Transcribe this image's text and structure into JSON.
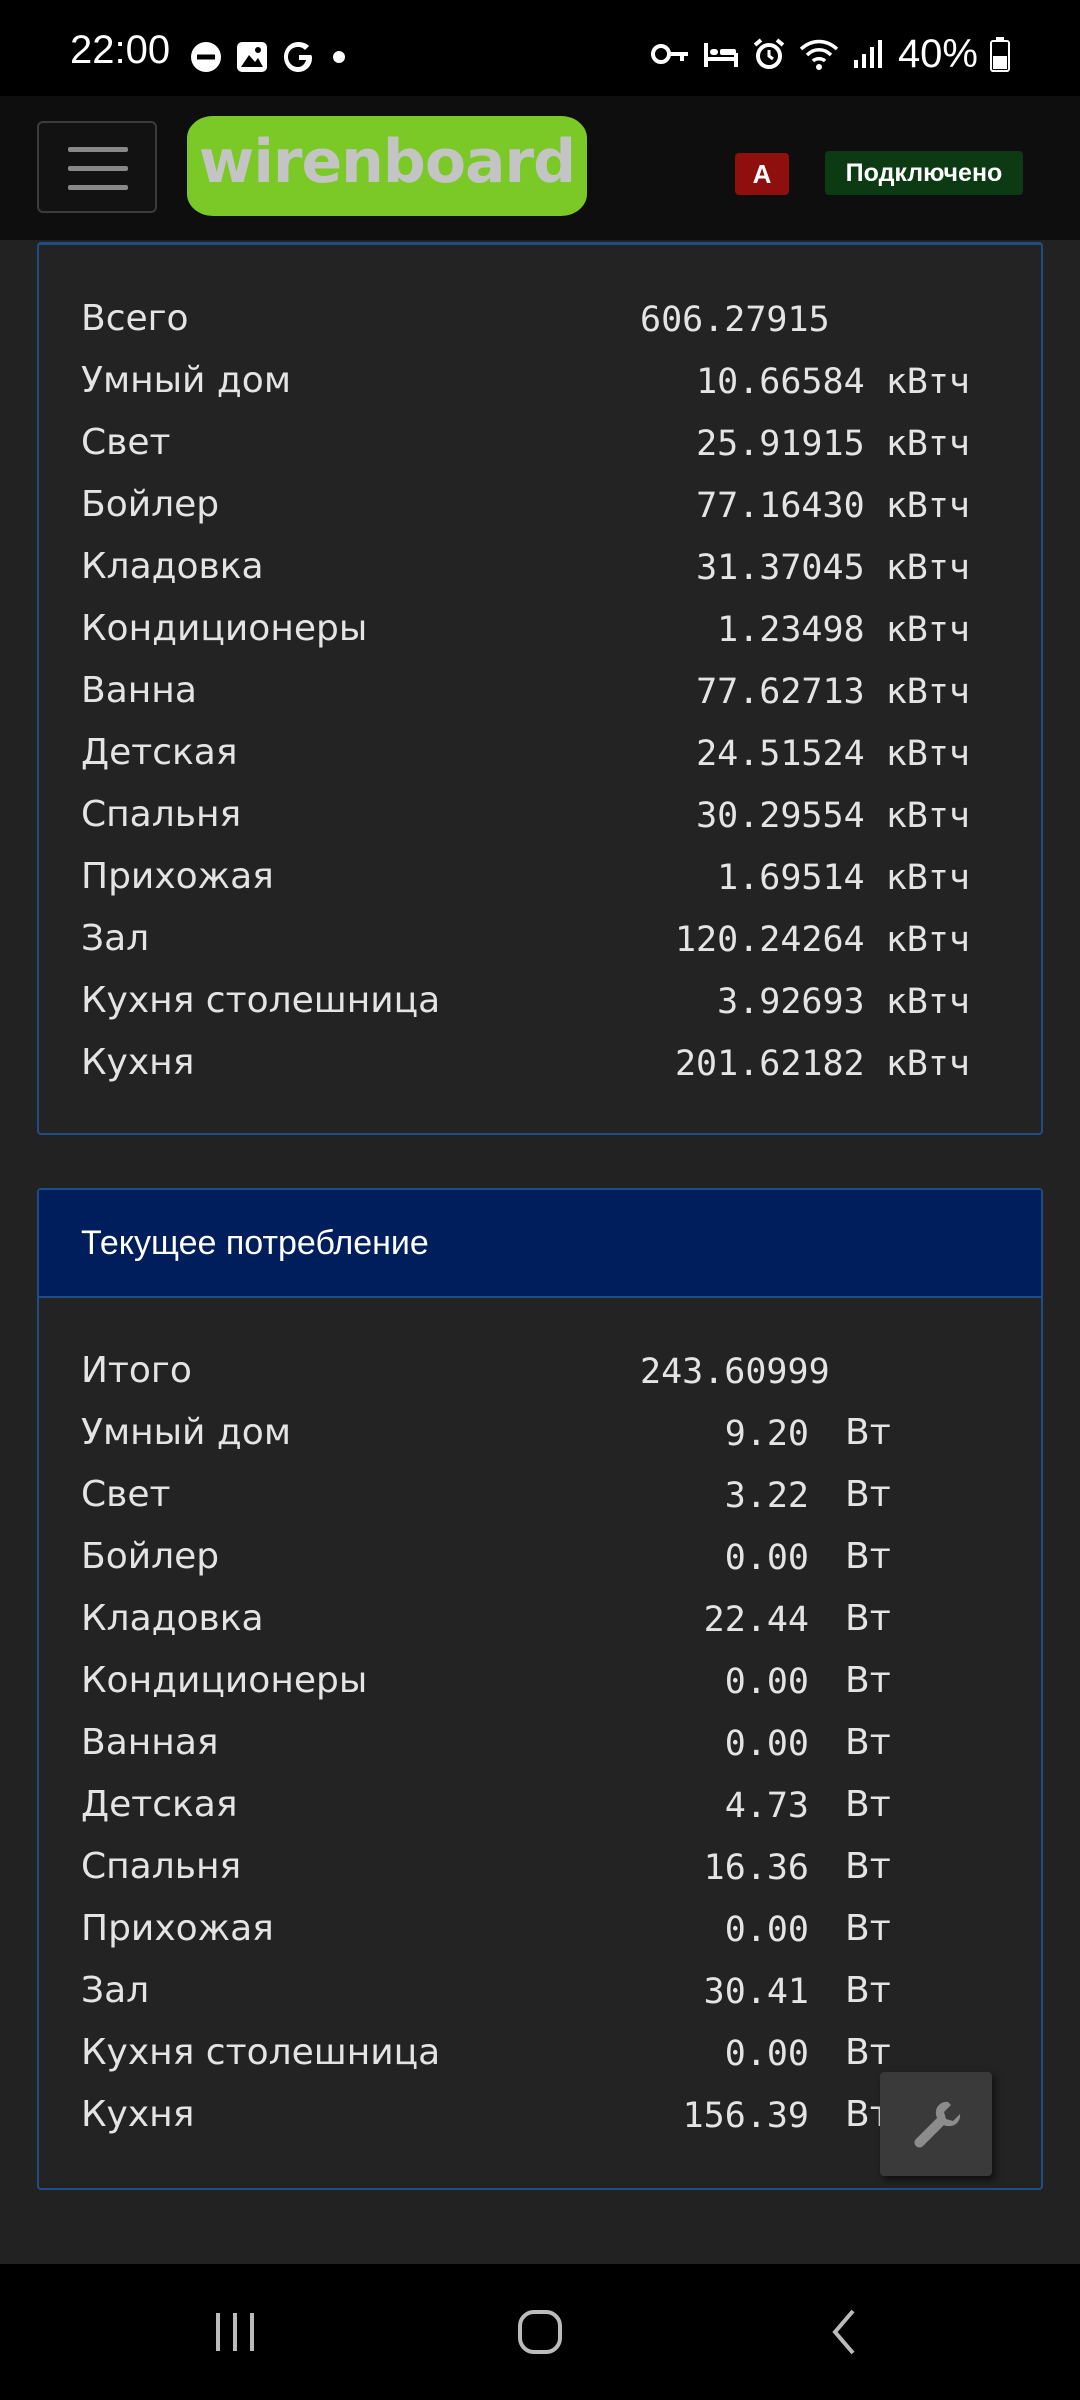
{
  "status_bar": {
    "time": "22:00",
    "battery_percent": "40%",
    "left_icons": [
      "do-not-disturb-icon",
      "gallery-icon",
      "google-icon",
      "dot-icon"
    ],
    "right_icons": [
      "key-icon",
      "bed-icon",
      "alarm-icon",
      "wifi-icon",
      "signal-icon",
      "battery-icon"
    ]
  },
  "navbar": {
    "logo_text": "wirenboard",
    "alert_badge": "A",
    "connection_status": "Подключено",
    "colors": {
      "logo": "#7ac927",
      "alert": "#8f0f0f",
      "connected": "#0c3a12"
    }
  },
  "energy_panel": {
    "rows": [
      {
        "label": "Всего",
        "value": "606.27915",
        "unit": ""
      },
      {
        "label": "Умный дом",
        "value": "10.66584 кВтч",
        "unit": ""
      },
      {
        "label": "Свет",
        "value": "25.91915 кВтч",
        "unit": ""
      },
      {
        "label": "Бойлер",
        "value": "77.16430 кВтч",
        "unit": ""
      },
      {
        "label": "Кладовка",
        "value": "31.37045 кВтч",
        "unit": ""
      },
      {
        "label": "Кондиционеры",
        "value": "1.23498 кВтч",
        "unit": ""
      },
      {
        "label": "Ванна",
        "value": "77.62713 кВтч",
        "unit": ""
      },
      {
        "label": "Детская",
        "value": "24.51524 кВтч",
        "unit": ""
      },
      {
        "label": "Спальня",
        "value": "30.29554 кВтч",
        "unit": ""
      },
      {
        "label": "Прихожая",
        "value": "1.69514 кВтч",
        "unit": ""
      },
      {
        "label": "Зал",
        "value": "120.24264 кВтч",
        "unit": ""
      },
      {
        "label": "Кухня столешница",
        "value": "3.92693 кВтч",
        "unit": ""
      },
      {
        "label": "Кухня",
        "value": "201.62182 кВтч",
        "unit": ""
      }
    ]
  },
  "power_panel": {
    "title": "Текущее потребление",
    "rows": [
      {
        "label": "Итого",
        "value": "243.60999",
        "unit": ""
      },
      {
        "label": "Умный дом",
        "value": "9.20",
        "unit": "Вт"
      },
      {
        "label": "Свет",
        "value": "3.22",
        "unit": "Вт"
      },
      {
        "label": "Бойлер",
        "value": "0.00",
        "unit": "Вт"
      },
      {
        "label": "Кладовка",
        "value": "22.44",
        "unit": "Вт"
      },
      {
        "label": "Кондиционеры",
        "value": "0.00",
        "unit": "Вт"
      },
      {
        "label": "Ванная",
        "value": "0.00",
        "unit": "Вт"
      },
      {
        "label": "Детская",
        "value": "4.73",
        "unit": "Вт"
      },
      {
        "label": "Спальня",
        "value": "16.36",
        "unit": "Вт"
      },
      {
        "label": "Прихожая",
        "value": "0.00",
        "unit": "Вт"
      },
      {
        "label": "Зал",
        "value": "30.41",
        "unit": "Вт"
      },
      {
        "label": "Кухня столешница",
        "value": "0.00",
        "unit": "Вт"
      },
      {
        "label": "Кухня",
        "value": "156.39",
        "unit": "Вт"
      }
    ]
  },
  "floating_button": {
    "icon": "wrench-icon"
  },
  "system_nav": {
    "icons": [
      "recents-icon",
      "home-icon",
      "back-icon"
    ]
  }
}
